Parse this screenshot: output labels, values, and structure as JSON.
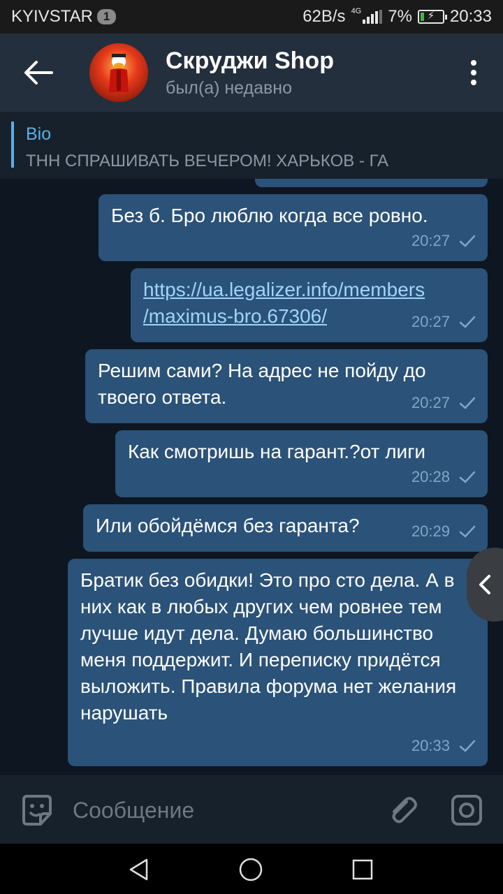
{
  "status_bar": {
    "carrier": "KYIVSTAR",
    "notification_count": "1",
    "net_speed": "62B/s",
    "net_type": "4G",
    "battery": "7%",
    "time": "20:33"
  },
  "header": {
    "title": "Скруджи Shop",
    "status": "был(а) недавно"
  },
  "bio": {
    "label": "Bio",
    "text": "ТНН СПРАШИВАТЬ ВЕЧЕРОМ! ХАРЬКОВ - ГА"
  },
  "messages": [
    {
      "text": "Без б. Бро люблю когда все ровно.",
      "time": "20:27",
      "is_link": false
    },
    {
      "text": "https://ua.legalizer.info/members/maximus-bro.67306/",
      "line1": "https://ua.legalizer.info/members",
      "line2": "/maximus-bro.67306/",
      "time": "20:27",
      "is_link": true
    },
    {
      "text": "Решим сами? На адрес не пойду до твоего ответа.",
      "time": "20:27",
      "is_link": false
    },
    {
      "text": "Как смотришь на гарант.?от лиги",
      "time": "20:28",
      "is_link": false
    },
    {
      "text": "Или обойдёмся без гаранта?",
      "time": "20:29",
      "is_link": false
    },
    {
      "text": "Братик без обидки! Это про сто дела. А в них как в любых других чем ровнее тем лучше идут дела. Думаю большинство меня поддержит. И переписку придётся выложить. Правила форума нет желания нарушать",
      "time": "20:33",
      "is_link": false
    }
  ],
  "input": {
    "placeholder": "Сообщение"
  },
  "colors": {
    "outgoing_bubble": "#2b5278",
    "chat_background": "#0e1621",
    "header_background": "#242f3d",
    "accent": "#5eaee4",
    "link": "#9fd4ff"
  },
  "icons": {
    "back": "arrow-left-icon",
    "menu": "more-vertical-icon",
    "emoji": "sticker-emoji-icon",
    "attach": "paperclip-icon",
    "camera": "instagram-camera-icon",
    "read": "single-check-icon",
    "side_handle": "chevron-left-icon"
  }
}
